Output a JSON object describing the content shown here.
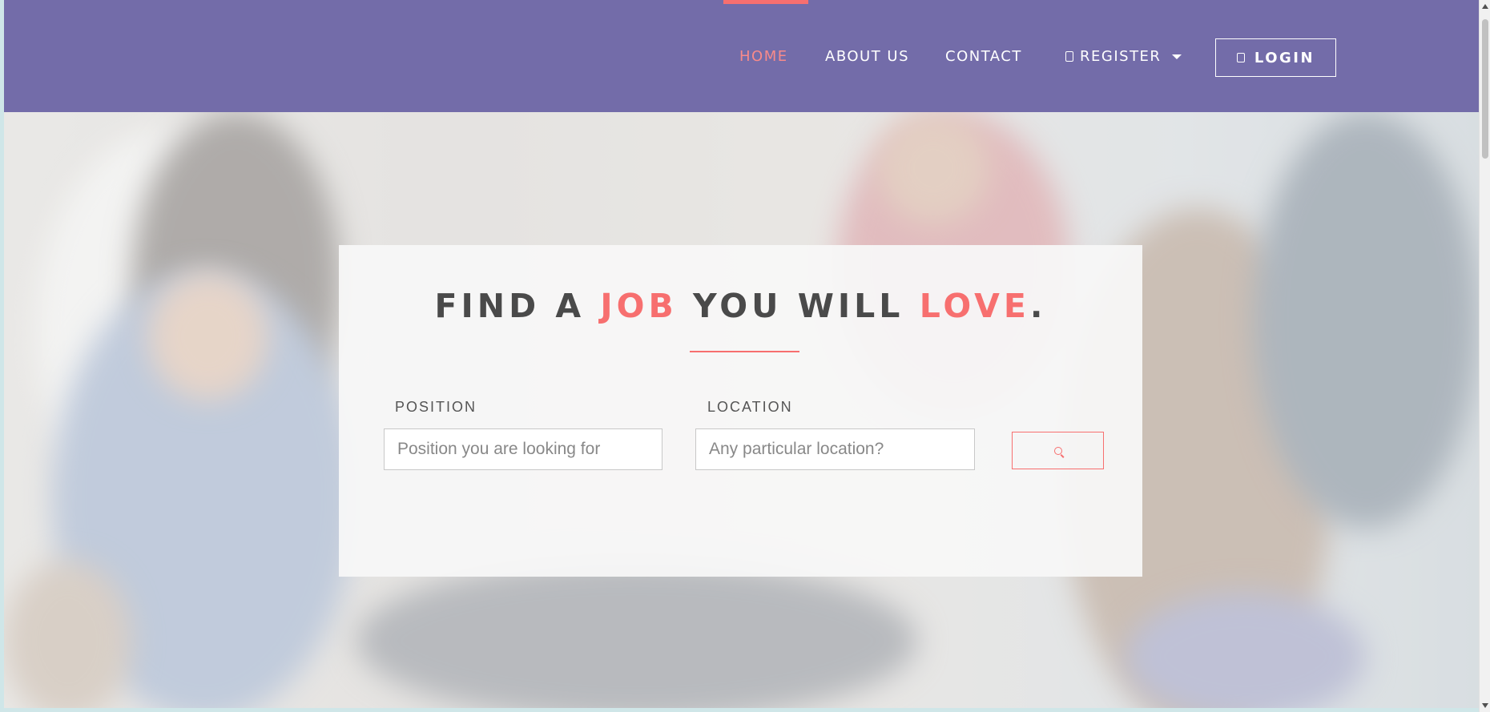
{
  "nav": {
    "home": "HOME",
    "about": "ABOUT US",
    "contact": "CONTACT",
    "register": "REGISTER",
    "login": "LOGIN",
    "active_item": "HOME"
  },
  "hero": {
    "headline_part1": "FIND A ",
    "headline_accent1": "JOB",
    "headline_part2": " YOU WILL ",
    "headline_accent2": "LOVE",
    "headline_part3": "."
  },
  "search": {
    "position_label": "POSITION",
    "position_placeholder": "Position you are looking for",
    "location_label": "LOCATION",
    "location_placeholder": "Any particular location?"
  },
  "icons": {
    "register": "user-icon",
    "register_dropdown": "caret-down-icon",
    "login": "lock-icon",
    "search": "search-icon"
  },
  "colors": {
    "navbar": "#736ca9",
    "accent": "#f76f6f",
    "headline": "#4a4a4a"
  }
}
